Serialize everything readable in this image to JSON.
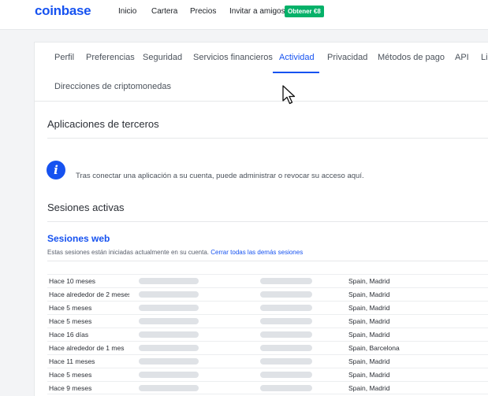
{
  "header": {
    "brand": "coinbase",
    "nav": [
      "Inicio",
      "Cartera",
      "Precios",
      "Invitar a amigos"
    ],
    "promo_label": "Obtener €8"
  },
  "tabs": [
    {
      "label": "Perfil",
      "active": false
    },
    {
      "label": "Preferencias",
      "active": false
    },
    {
      "label": "Seguridad",
      "active": false
    },
    {
      "label": "Servicios financieros",
      "active": false
    },
    {
      "label": "Actividad",
      "active": true
    },
    {
      "label": "Privacidad",
      "active": false
    },
    {
      "label": "Métodos de pago",
      "active": false
    },
    {
      "label": "API",
      "active": false
    },
    {
      "label": "Li",
      "active": false
    },
    {
      "label": "Direcciones de criptomonedas",
      "active": false
    }
  ],
  "third_party": {
    "title": "Aplicaciones de terceros",
    "info_text": "Tras conectar una aplicación a su cuenta, puede administrar o revocar su acceso aquí."
  },
  "active_sessions": {
    "title": "Sesiones activas",
    "web_title": "Sesiones web",
    "web_desc": "Estas sesiones están iniciadas actualmente en su cuenta.",
    "close_all_link": "Cerrar todas las demás sesiones",
    "rows": [
      {
        "time": "Hace 10 meses",
        "location": "Spain, Madrid"
      },
      {
        "time": "Hace alrededor de 2 meses",
        "location": "Spain, Madrid"
      },
      {
        "time": "Hace 5 meses",
        "location": "Spain, Madrid"
      },
      {
        "time": "Hace 5 meses",
        "location": "Spain, Madrid"
      },
      {
        "time": "Hace 16 días",
        "location": "Spain, Madrid"
      },
      {
        "time": "Hace alrededor de 1 mes",
        "location": "Spain, Barcelona"
      },
      {
        "time": "Hace 11 meses",
        "location": "Spain, Madrid"
      },
      {
        "time": "Hace 5 meses",
        "location": "Spain, Madrid"
      },
      {
        "time": "Hace 9 meses",
        "location": "Spain, Madrid"
      }
    ]
  },
  "colors": {
    "brand": "#1652f0",
    "promo": "#05b169"
  },
  "icons": {
    "info": "info-icon",
    "cursor": "mouse-pointer-icon"
  }
}
